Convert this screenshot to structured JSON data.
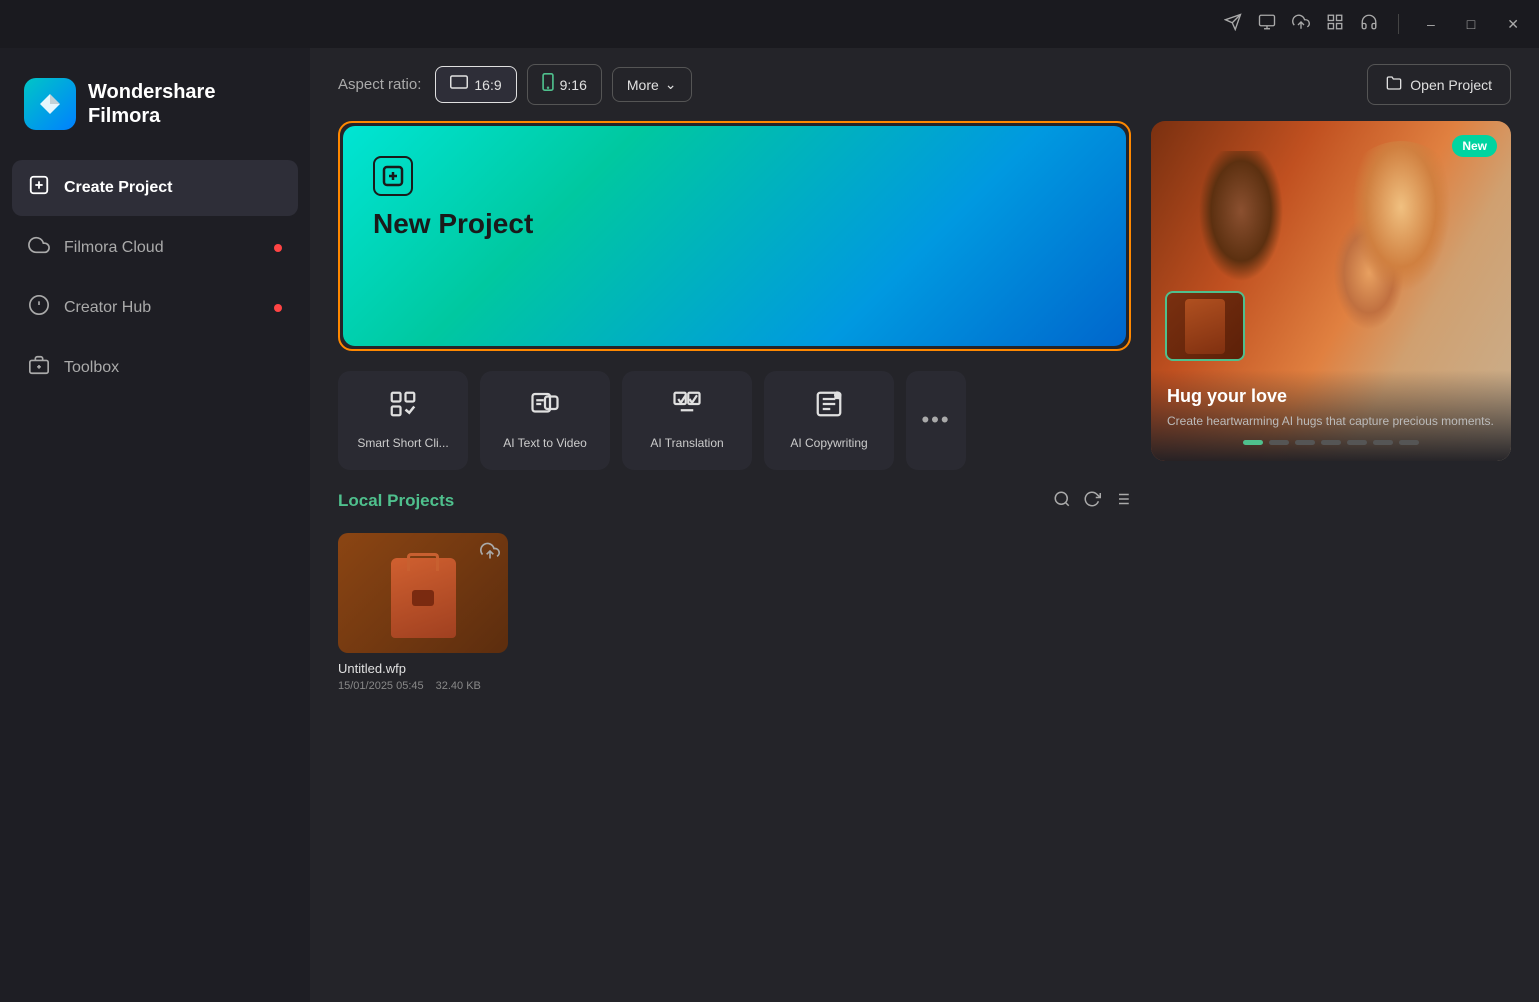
{
  "app": {
    "name": "Wondershare Filmora"
  },
  "titlebar": {
    "icons": [
      "send-icon",
      "screen-icon",
      "upload-icon",
      "grid-icon",
      "headphone-icon"
    ],
    "controls": [
      "minimize",
      "maximize",
      "close"
    ]
  },
  "sidebar": {
    "logo_text": "Wondershare\nFilmora",
    "items": [
      {
        "id": "create-project",
        "label": "Create Project",
        "active": true,
        "dot": false
      },
      {
        "id": "filmora-cloud",
        "label": "Filmora Cloud",
        "active": false,
        "dot": true
      },
      {
        "id": "creator-hub",
        "label": "Creator Hub",
        "active": false,
        "dot": true
      },
      {
        "id": "toolbox",
        "label": "Toolbox",
        "active": false,
        "dot": false
      }
    ]
  },
  "topbar": {
    "aspect_ratio_label": "Aspect ratio:",
    "aspect_options": [
      {
        "id": "16-9",
        "label": "16:9",
        "active": true,
        "icon": "monitor"
      },
      {
        "id": "9-16",
        "label": "9:16",
        "active": false,
        "icon": "mobile"
      }
    ],
    "more_button_label": "More",
    "open_project_label": "Open Project"
  },
  "new_project": {
    "label": "New Project",
    "icon": "plus"
  },
  "ai_tools": [
    {
      "id": "smart-short-clip",
      "label": "Smart Short Cli..."
    },
    {
      "id": "ai-text-to-video",
      "label": "AI Text to Video"
    },
    {
      "id": "ai-translation",
      "label": "AI Translation"
    },
    {
      "id": "ai-copywriting",
      "label": "AI Copywriting"
    }
  ],
  "ai_tools_more": "...",
  "local_projects": {
    "title": "Local Projects",
    "items": [
      {
        "name": "Untitled.wfp",
        "date": "15/01/2025 05:45",
        "size": "32.40 KB"
      }
    ]
  },
  "promo": {
    "badge": "New",
    "title": "Hug your love",
    "description": "Create heartwarming AI hugs that capture precious moments.",
    "dots": [
      true,
      false,
      false,
      false,
      false,
      false,
      false
    ]
  },
  "colors": {
    "accent_green": "#4fc08d",
    "accent_orange": "#ff8800",
    "sidebar_bg": "#1e1e24",
    "main_bg": "#242429",
    "card_bg": "#2a2a32",
    "new_project_badge": "#00d4a0"
  }
}
